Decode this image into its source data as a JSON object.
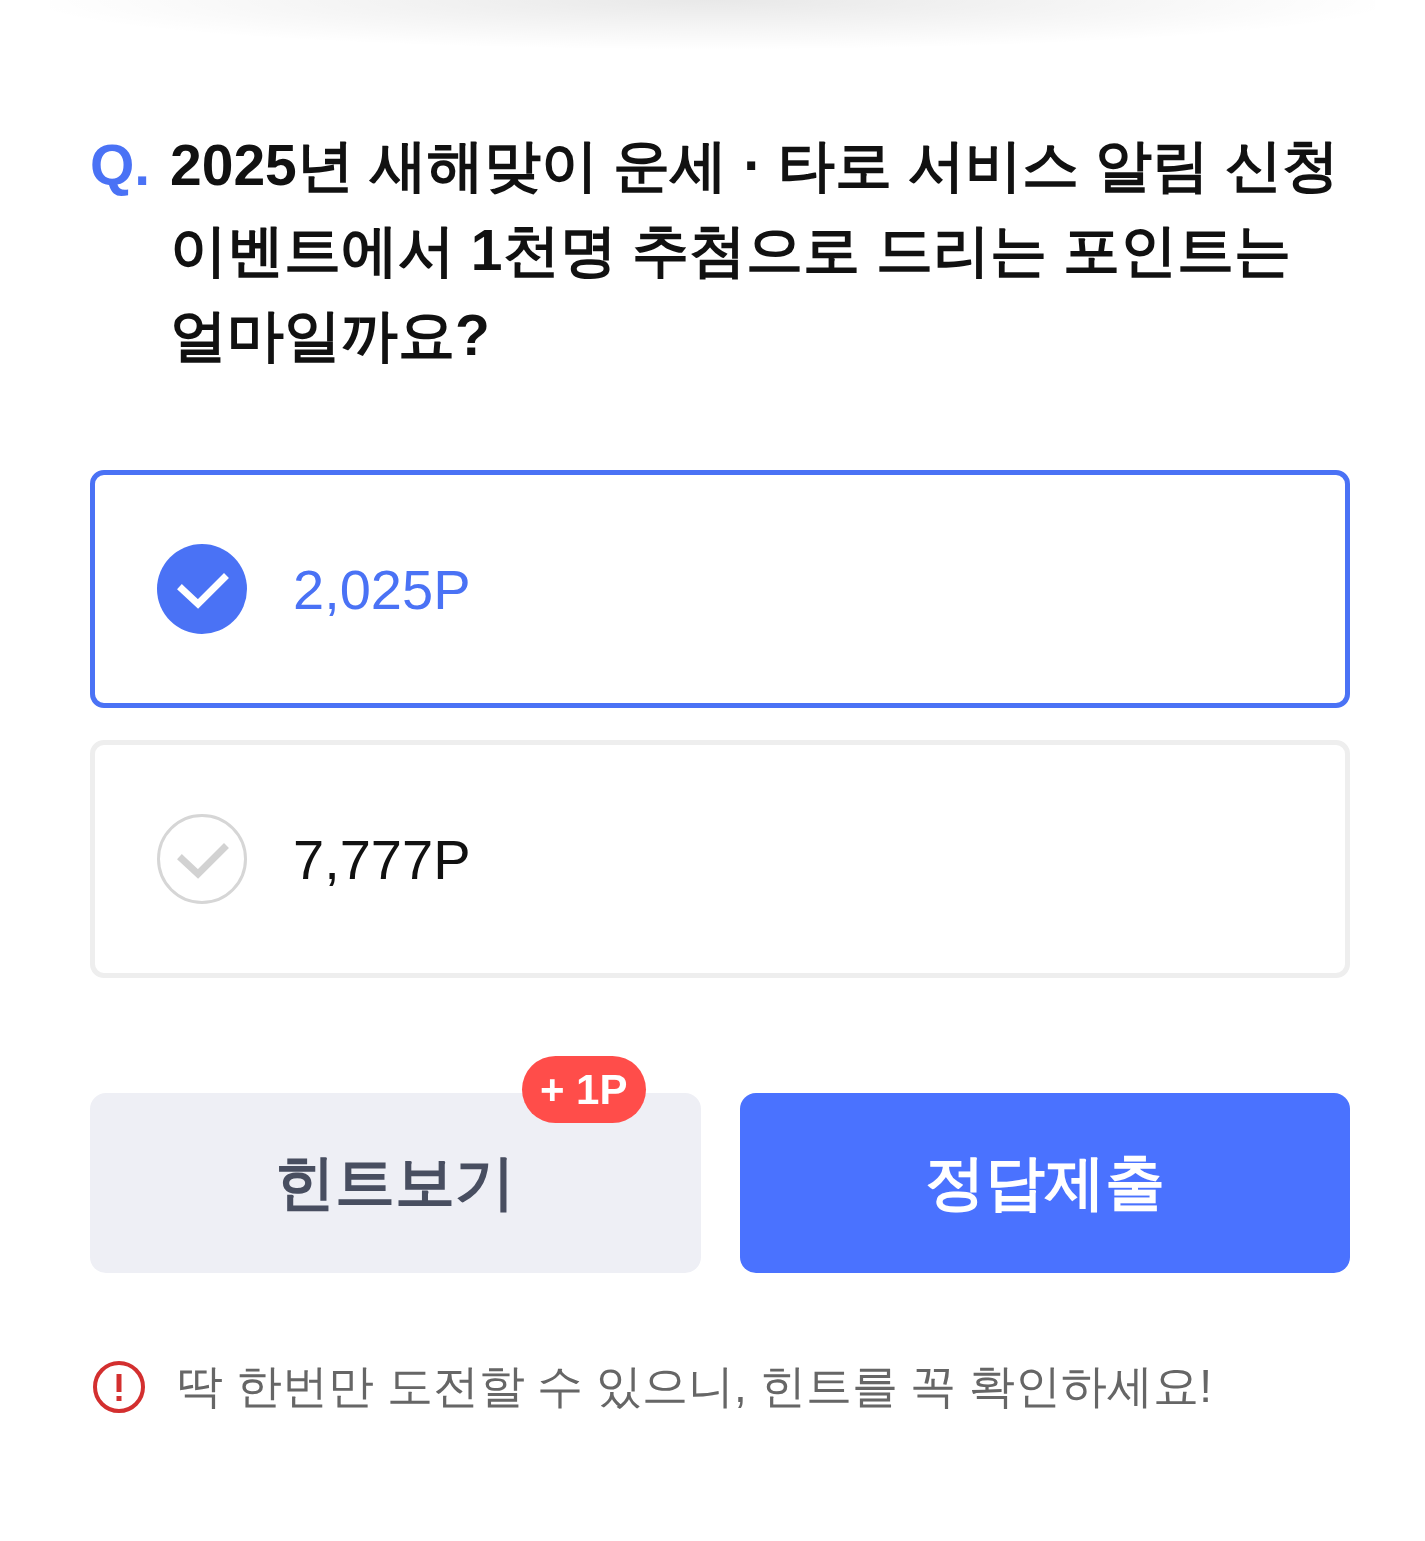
{
  "question": {
    "marker": "Q.",
    "text": "2025년 새해맞이 운세 · 타로 서비스 알림 신청 이벤트에서 1천명 추첨으로 드리는 포인트는 얼마일까요?"
  },
  "options": [
    {
      "label": "2,025P",
      "selected": true
    },
    {
      "label": "7,777P",
      "selected": false
    }
  ],
  "hint_button": {
    "label": "힌트보기",
    "badge": "+ 1P"
  },
  "submit_button": {
    "label": "정답제출"
  },
  "notice": "딱 한번만 도전할 수 있으니, 힌트를 꼭 확인하세요!"
}
